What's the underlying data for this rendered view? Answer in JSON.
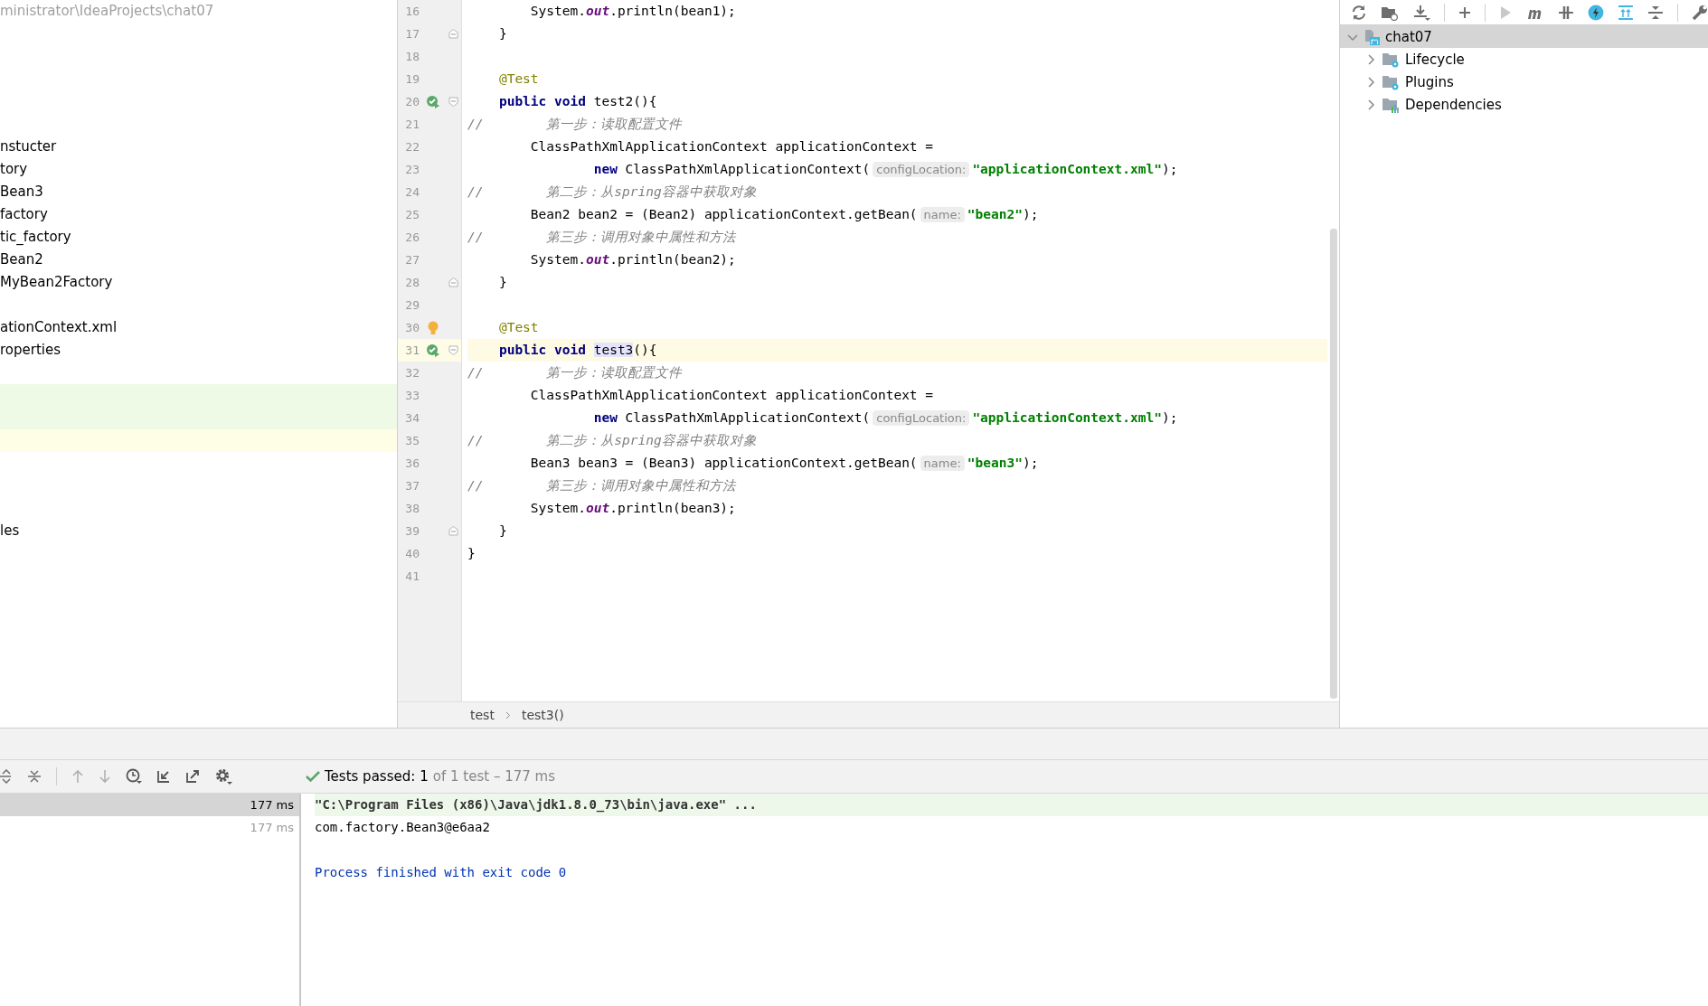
{
  "project_panel": {
    "path": "ministrator\\IdeaProjects\\chat07",
    "rows": [
      {
        "kind": "blank"
      },
      {
        "kind": "blank"
      },
      {
        "kind": "blank"
      },
      {
        "kind": "blank"
      },
      {
        "kind": "blank"
      },
      {
        "kind": "item",
        "label": "nstucter"
      },
      {
        "kind": "item",
        "label": "tory"
      },
      {
        "kind": "item",
        "label": "Bean3"
      },
      {
        "kind": "item",
        "label": "factory"
      },
      {
        "kind": "item",
        "label": "tic_factory"
      },
      {
        "kind": "item",
        "label": "Bean2"
      },
      {
        "kind": "item",
        "label": "MyBean2Factory"
      },
      {
        "kind": "blank"
      },
      {
        "kind": "item",
        "label": "ationContext.xml"
      },
      {
        "kind": "item",
        "label": "roperties"
      },
      {
        "kind": "blank"
      },
      {
        "kind": "added"
      },
      {
        "kind": "added"
      },
      {
        "kind": "modified"
      },
      {
        "kind": "blank"
      },
      {
        "kind": "blank"
      },
      {
        "kind": "blank"
      },
      {
        "kind": "item",
        "label": "les"
      }
    ]
  },
  "editor": {
    "lines": [
      {
        "number": "16",
        "tokens": [
          {
            "kind": "plain",
            "text": "        System."
          },
          {
            "kind": "static",
            "text": "out"
          },
          {
            "kind": "plain",
            "text": ".println(bean1);"
          }
        ]
      },
      {
        "number": "17",
        "fold_end": true,
        "tokens": [
          {
            "kind": "plain",
            "text": "    }"
          }
        ]
      },
      {
        "number": "18"
      },
      {
        "number": "19",
        "tokens": [
          {
            "kind": "annotation",
            "text": "    @Test"
          }
        ]
      },
      {
        "number": "20",
        "run_marker": true,
        "fold_start": true,
        "tokens": [
          {
            "kind": "keyword",
            "text": "    public void"
          },
          {
            "kind": "plain",
            "text": " test2(){"
          }
        ]
      },
      {
        "number": "21",
        "tokens": [
          {
            "kind": "comment",
            "text": "//        第一步：读取配置文件"
          }
        ]
      },
      {
        "number": "22",
        "tokens": [
          {
            "kind": "plain",
            "text": "        ClassPathXmlApplicationContext applicationContext ="
          }
        ]
      },
      {
        "number": "23",
        "tokens": [
          {
            "kind": "keyword",
            "text": "                new"
          },
          {
            "kind": "plain",
            "text": " ClassPathXmlApplicationContext("
          },
          {
            "kind": "hint",
            "text": "configLocation:"
          },
          {
            "kind": "string",
            "text": "\"applicationContext.xml\""
          },
          {
            "kind": "plain",
            "text": ");"
          }
        ]
      },
      {
        "number": "24",
        "tokens": [
          {
            "kind": "comment",
            "text": "//        第二步：从spring容器中获取对象"
          }
        ]
      },
      {
        "number": "25",
        "tokens": [
          {
            "kind": "plain",
            "text": "        Bean2 bean2 = (Bean2) applicationContext.getBean("
          },
          {
            "kind": "hint",
            "text": "name:"
          },
          {
            "kind": "string",
            "text": "\"bean2\""
          },
          {
            "kind": "plain",
            "text": ");"
          }
        ]
      },
      {
        "number": "26",
        "tokens": [
          {
            "kind": "comment",
            "text": "//        第三步：调用对象中属性和方法"
          }
        ]
      },
      {
        "number": "27",
        "tokens": [
          {
            "kind": "plain",
            "text": "        System."
          },
          {
            "kind": "static",
            "text": "out"
          },
          {
            "kind": "plain",
            "text": ".println(bean2);"
          }
        ]
      },
      {
        "number": "28",
        "fold_end": true,
        "tokens": [
          {
            "kind": "plain",
            "text": "    }"
          }
        ]
      },
      {
        "number": "29"
      },
      {
        "number": "30",
        "bulb": true,
        "tokens": [
          {
            "kind": "annotation",
            "text": "    @Test"
          }
        ]
      },
      {
        "number": "31",
        "run_marker": true,
        "fold_start": true,
        "current": true,
        "tokens": [
          {
            "kind": "keyword",
            "text": "    public void "
          },
          {
            "kind": "usage",
            "text": "test3"
          },
          {
            "kind": "plain",
            "text": "(){"
          }
        ]
      },
      {
        "number": "32",
        "tokens": [
          {
            "kind": "comment",
            "text": "//        第一步：读取配置文件"
          }
        ]
      },
      {
        "number": "33",
        "tokens": [
          {
            "kind": "plain",
            "text": "        ClassPathXmlApplicationContext applicationContext ="
          }
        ]
      },
      {
        "number": "34",
        "tokens": [
          {
            "kind": "keyword",
            "text": "                new"
          },
          {
            "kind": "plain",
            "text": " ClassPathXmlApplicationContext("
          },
          {
            "kind": "hint",
            "text": "configLocation:"
          },
          {
            "kind": "string",
            "text": "\"applicationContext.xml\""
          },
          {
            "kind": "plain",
            "text": ");"
          }
        ]
      },
      {
        "number": "35",
        "tokens": [
          {
            "kind": "comment",
            "text": "//        第二步：从spring容器中获取对象"
          }
        ]
      },
      {
        "number": "36",
        "tokens": [
          {
            "kind": "plain",
            "text": "        Bean3 bean3 = (Bean3) applicationContext.getBean("
          },
          {
            "kind": "hint",
            "text": "name:"
          },
          {
            "kind": "string",
            "text": "\"bean3\""
          },
          {
            "kind": "plain",
            "text": ");"
          }
        ]
      },
      {
        "number": "37",
        "tokens": [
          {
            "kind": "comment",
            "text": "//        第三步：调用对象中属性和方法"
          }
        ]
      },
      {
        "number": "38",
        "tokens": [
          {
            "kind": "plain",
            "text": "        System."
          },
          {
            "kind": "static",
            "text": "out"
          },
          {
            "kind": "plain",
            "text": ".println(bean3);"
          }
        ]
      },
      {
        "number": "39",
        "fold_end": true,
        "tokens": [
          {
            "kind": "plain",
            "text": "    }"
          }
        ]
      },
      {
        "number": "40",
        "tokens": [
          {
            "kind": "plain",
            "text": "}"
          }
        ]
      },
      {
        "number": "41"
      }
    ],
    "breadcrumbs": [
      "test",
      "test3()"
    ]
  },
  "maven_panel": {
    "tree": [
      {
        "label": "chat07",
        "kind": "module",
        "expanded": true,
        "selected": true,
        "children": [
          {
            "label": "Lifecycle",
            "kind": "folder",
            "expanded": false,
            "selected": false
          },
          {
            "label": "Plugins",
            "kind": "folder",
            "expanded": false,
            "selected": false
          },
          {
            "label": "Dependencies",
            "kind": "dependencies",
            "expanded": false,
            "selected": false
          }
        ]
      }
    ]
  },
  "run_panel": {
    "status": {
      "label": "Tests passed:",
      "count": "1",
      "detail": "of 1 test – 177 ms"
    },
    "test_rows": [
      {
        "duration": "177 ms",
        "selected": true
      },
      {
        "duration": "177 ms",
        "selected": false
      }
    ],
    "console": [
      {
        "kind": "command",
        "text": "\"C:\\Program Files (x86)\\Java\\jdk1.8.0_73\\bin\\java.exe\" ..."
      },
      {
        "kind": "output",
        "text": "com.factory.Bean3@e6aa2"
      },
      {
        "kind": "blank"
      },
      {
        "kind": "exit",
        "text": "Process finished with exit code 0"
      }
    ]
  }
}
